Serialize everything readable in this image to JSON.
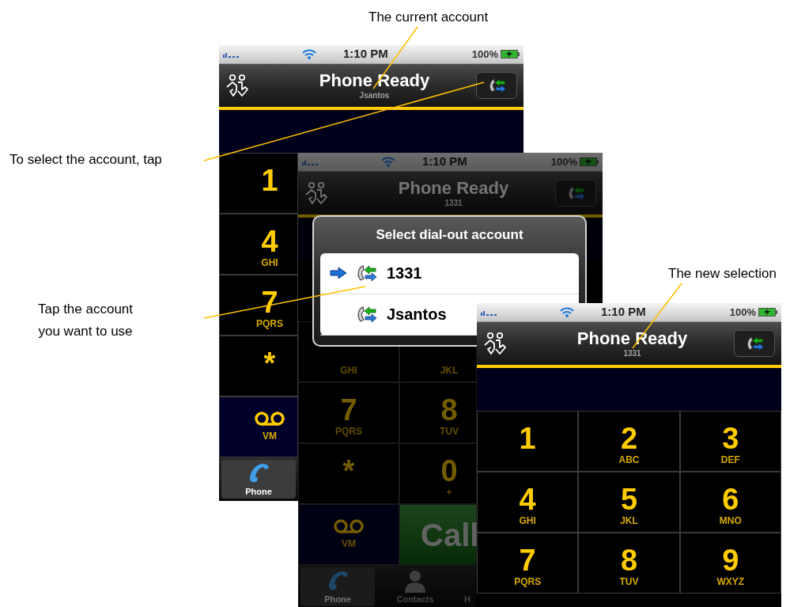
{
  "callouts": [
    {
      "lines": [
        "The current account"
      ]
    },
    {
      "lines": [
        "To select the account, tap"
      ]
    },
    {
      "lines": [
        "Tap the account",
        "you want to use"
      ]
    },
    {
      "lines": [
        "The new selection"
      ]
    }
  ],
  "screens": [
    {
      "dimmed": false,
      "status_bar": {
        "time": "1:10 PM",
        "battery": "100%"
      },
      "nav_bar": {
        "title": "Phone Ready",
        "subtitle": "Jsantos"
      },
      "keypad": [
        [
          {
            "kind": "digit",
            "digit": "1"
          }
        ],
        [
          {
            "kind": "digit",
            "digit": "4",
            "letters": "GHI"
          }
        ],
        [
          {
            "kind": "digit",
            "digit": "7",
            "letters": "PQRS"
          }
        ],
        [
          {
            "kind": "digit",
            "digit": "*"
          }
        ],
        [
          {
            "kind": "voicemail",
            "letters": "VM"
          }
        ]
      ],
      "tabs": [
        {
          "kind": "phone",
          "label": "Phone",
          "selected": true,
          "clipped": false
        }
      ]
    },
    {
      "dimmed": true,
      "status_bar": {
        "time": "1:10 PM",
        "battery": "100%"
      },
      "nav_bar": {
        "title": "Phone Ready",
        "subtitle": "1331"
      },
      "dialog": {
        "title": "Select dial-out account",
        "accounts": [
          {
            "label": "1331",
            "selected": true
          },
          {
            "label": "Jsantos",
            "selected": false
          }
        ]
      },
      "keypad": [
        [
          {
            "kind": "digit",
            "letters": "GHI"
          },
          {
            "kind": "digit",
            "letters": "JKL"
          }
        ],
        [
          {
            "kind": "digit",
            "digit": "7",
            "letters": "PQRS"
          },
          {
            "kind": "digit",
            "digit": "8",
            "letters": "TUV"
          }
        ],
        [
          {
            "kind": "digit",
            "digit": "*"
          },
          {
            "kind": "digit",
            "digit": "0",
            "letters": "+"
          }
        ],
        [
          {
            "kind": "voicemail",
            "letters": "VM"
          },
          {
            "kind": "call",
            "label": "Call"
          }
        ]
      ],
      "tabs": [
        {
          "kind": "phone",
          "label": "Phone",
          "selected": true,
          "clipped": false
        },
        {
          "kind": "contacts",
          "label": "Contacts",
          "selected": false,
          "clipped": false
        },
        {
          "kind": "other",
          "label": "H",
          "selected": false,
          "clipped": true
        }
      ]
    },
    {
      "dimmed": false,
      "status_bar": {
        "time": "1:10 PM",
        "battery": "100%"
      },
      "nav_bar": {
        "title": "Phone Ready",
        "subtitle": "1331"
      },
      "keypad": [
        [
          {
            "kind": "digit",
            "digit": "1"
          },
          {
            "kind": "digit",
            "digit": "2",
            "letters": "ABC"
          },
          {
            "kind": "digit",
            "digit": "3",
            "letters": "DEF"
          }
        ],
        [
          {
            "kind": "digit",
            "digit": "4",
            "letters": "GHI"
          },
          {
            "kind": "digit",
            "digit": "5",
            "letters": "JKL"
          },
          {
            "kind": "digit",
            "digit": "6",
            "letters": "MNO"
          }
        ],
        [
          {
            "kind": "digit",
            "digit": "7",
            "letters": "PQRS"
          },
          {
            "kind": "digit",
            "digit": "8",
            "letters": "TUV"
          },
          {
            "kind": "digit",
            "digit": "9",
            "letters": "WXYZ"
          }
        ]
      ]
    }
  ]
}
